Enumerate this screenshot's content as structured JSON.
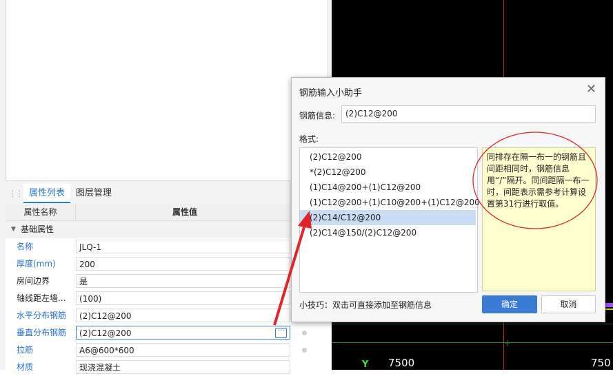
{
  "left_panel": {
    "tabs": [
      "属性列表",
      "图层管理"
    ],
    "grid": {
      "header_name": "属性名称",
      "header_value": "属性值",
      "group": "基础属性",
      "rows": [
        {
          "label": "名称",
          "value": "JLQ-1",
          "blue": true
        },
        {
          "label": "厚度(mm)",
          "value": "200",
          "blue": true
        },
        {
          "label": "房间边界",
          "value": "是",
          "blue": false
        },
        {
          "label": "轴线距左墙...",
          "value": "(100)",
          "blue": false
        },
        {
          "label": "水平分布钢筋",
          "value": "(2)C12@200",
          "blue": true
        },
        {
          "label": "垂直分布钢筋",
          "value": "(2)C12@200",
          "blue": true
        },
        {
          "label": "拉筋",
          "value": "A6@600*600",
          "blue": true
        },
        {
          "label": "材质",
          "value": "现浇混凝土",
          "blue": true
        }
      ],
      "ellipsis_glyph": "···"
    }
  },
  "cad": {
    "label_left": "7500",
    "label_right": "750",
    "axis_y": "Y"
  },
  "dialog": {
    "title": "钢筋输入小助手",
    "close_glyph": "✕",
    "info_label": "钢筋信息:",
    "info_value": "(2)C12@200",
    "format_label": "格式:",
    "formats": [
      "(2)C12@200",
      "*(2)C12@200",
      "(1)C14@200+(1)C12@200",
      "(1)C12@200+(1)C10@200+(1)C12@200",
      "(2)C14/C12@200",
      "(2)C14@150/(2)C12@200"
    ],
    "selected_index": 4,
    "help_text": "同排存在隔一布一的钢筋且间距相同时，钢筋信息用“/”隔开。同间距隔一布一时，间距表示需参考计算设置第31行进行取值。",
    "tip": "小技巧：双击可直接添加至钢筋信息",
    "ok_label": "确定",
    "cancel_label": "取消"
  },
  "colors": {
    "accent": "#3a7bd5",
    "annotation": "#e0252a",
    "help_bg": "#ffffd0",
    "selection": "#c9dcf4"
  }
}
